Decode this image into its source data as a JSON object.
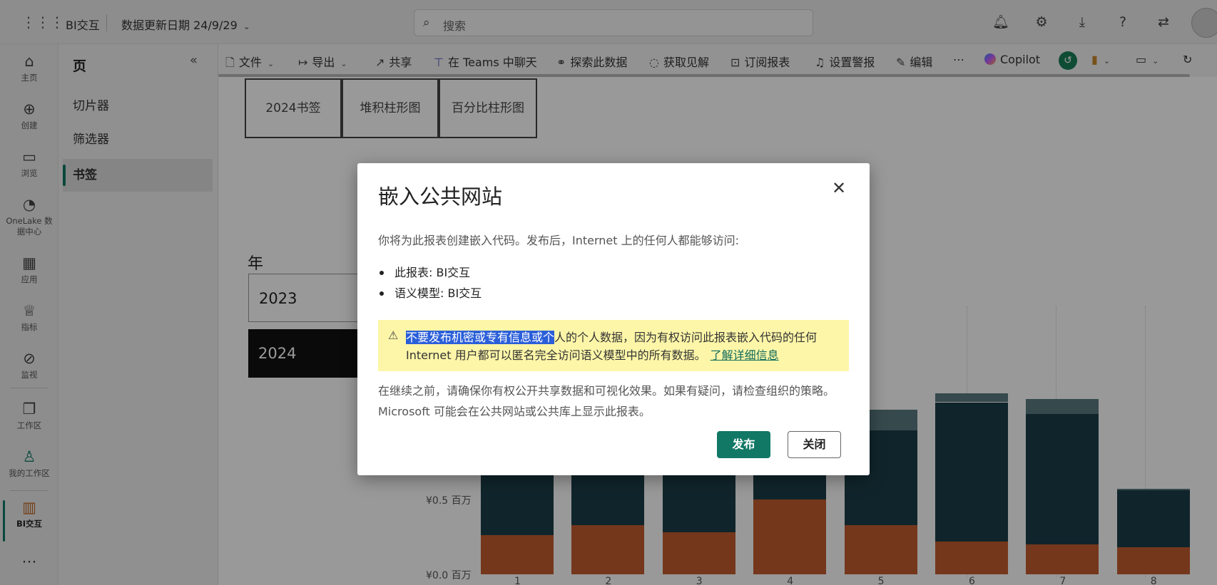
{
  "topbar": {
    "app_name": "BI交互",
    "data_date": "数据更新日期 24/9/29",
    "search_placeholder": "搜索"
  },
  "rail": {
    "items": [
      {
        "label": "主页",
        "icon": "home-icon"
      },
      {
        "label": "创建",
        "icon": "plus-circle-icon"
      },
      {
        "label": "浏览",
        "icon": "folder-icon"
      },
      {
        "label": "OneLake 数据中心",
        "icon": "onelake-icon"
      },
      {
        "label": "应用",
        "icon": "apps-icon"
      },
      {
        "label": "指标",
        "icon": "trophy-icon"
      },
      {
        "label": "监视",
        "icon": "monitor-icon"
      },
      {
        "label": "工作区",
        "icon": "workspaces-icon"
      },
      {
        "label": "我的工作区",
        "icon": "person-icon"
      },
      {
        "label": "BI交互",
        "icon": "report-icon"
      }
    ]
  },
  "pages": {
    "title": "页",
    "items": [
      "切片器",
      "筛选器",
      "书签"
    ],
    "active_index": 2
  },
  "toolbar": {
    "file": "文件",
    "export": "导出",
    "share": "共享",
    "teams": "在 Teams 中聊天",
    "explore": "探索此数据",
    "insights": "获取见解",
    "subscribe": "订阅报表",
    "alert": "设置警报",
    "edit": "编辑",
    "more": "⋯",
    "copilot": "Copilot"
  },
  "report": {
    "bookmark_buttons": [
      "2024书签",
      "堆积柱形图",
      "百分比柱形图"
    ],
    "slicer_title": "年",
    "slicer_items": [
      "2023",
      "2024"
    ],
    "slicer_selected": "2024"
  },
  "chart_data": {
    "type": "bar",
    "stacked": true,
    "categories": [
      "1",
      "2",
      "3",
      "4",
      "5",
      "6",
      "7",
      "8"
    ],
    "y_tick_labels": [
      "¥0.0 百万",
      "¥0.5 百万"
    ],
    "ylim": [
      0,
      1.3
    ],
    "series": [
      {
        "color": "#c45c30",
        "values": [
          0.26,
          0.33,
          0.28,
          0.5,
          0.33,
          0.22,
          0.2,
          0.18
        ]
      },
      {
        "color": "#1c3f48",
        "values": [
          0.65,
          0.45,
          0.48,
          0.55,
          0.63,
          0.93,
          0.87,
          0.38
        ]
      },
      {
        "color": "#5b7a80",
        "values": [
          0.05,
          0.05,
          0.05,
          0.05,
          0.14,
          0.06,
          0.1,
          0.01
        ]
      }
    ]
  },
  "dialog": {
    "title": "嵌入公共网站",
    "intro": "你将为此报表创建嵌入代码。发布后，Internet 上的任何人都能够访问:",
    "list": [
      "此报表: BI交互",
      "语义模型: BI交互"
    ],
    "warning_highlight": "不要发布机密或专有信息或个",
    "warning_rest": "人的个人数据，因为有权访问此报表嵌入代码的任何 Internet 用户都可以匿名完全访问语义模型中的所有数据。",
    "warning_link": "了解详细信息",
    "note": "在继续之前，请确保你有权公开共享数据和可视化效果。如果有疑问，请检查组织的策略。Microsoft 可能会在公共网站或公共库上显示此报表。",
    "publish": "发布",
    "close": "关闭"
  }
}
